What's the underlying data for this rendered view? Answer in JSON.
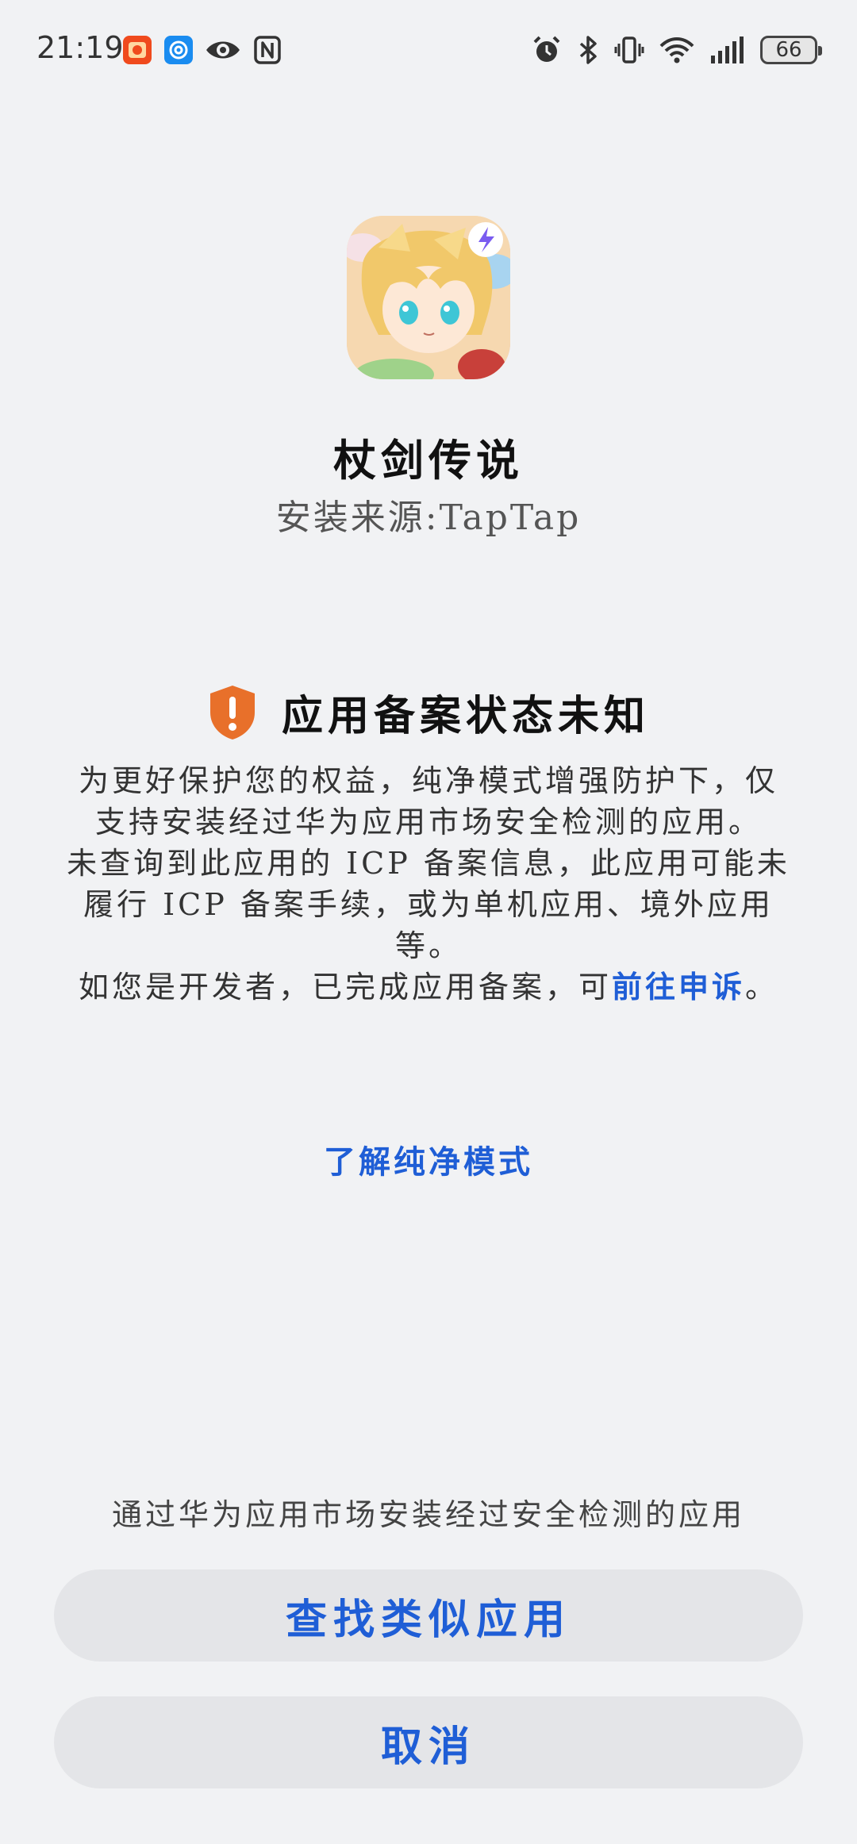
{
  "status_bar": {
    "time": "21:19",
    "battery": "66",
    "left_icons": [
      "taobao-app-icon",
      "app-notification-icon",
      "eye-comfort-icon",
      "nfc-icon"
    ],
    "right_icons": [
      "alarm-icon",
      "bluetooth-icon",
      "vibrate-icon",
      "wifi-icon",
      "signal-icon",
      "battery-icon"
    ]
  },
  "app": {
    "name": "杖剑传说",
    "install_source": "安装来源:TapTap",
    "icon": "app-icon"
  },
  "warning": {
    "icon": "shield-alert-icon",
    "icon_color": "#e8702a",
    "title": "应用备案状态未知",
    "paragraph1": "为更好保护您的权益，纯净模式增强防护下，仅支持安装经过华为应用市场安全检测的应用。",
    "paragraph2": "未查询到此应用的 ICP 备案信息，此应用可能未履行 ICP 备案手续，或为单机应用、境外应用等。",
    "paragraph3_prefix": "如您是开发者，已完成应用备案，可",
    "paragraph3_link": "前往申诉",
    "paragraph3_suffix": "。"
  },
  "learn_more": "了解纯净模式",
  "bottom_note": "通过华为应用市场安装经过安全检测的应用",
  "buttons": {
    "find_similar": "查找类似应用",
    "cancel": "取消"
  },
  "colors": {
    "accent": "#1f5ed6",
    "background": "#f1f2f4",
    "button_bg": "#e4e5e8"
  }
}
